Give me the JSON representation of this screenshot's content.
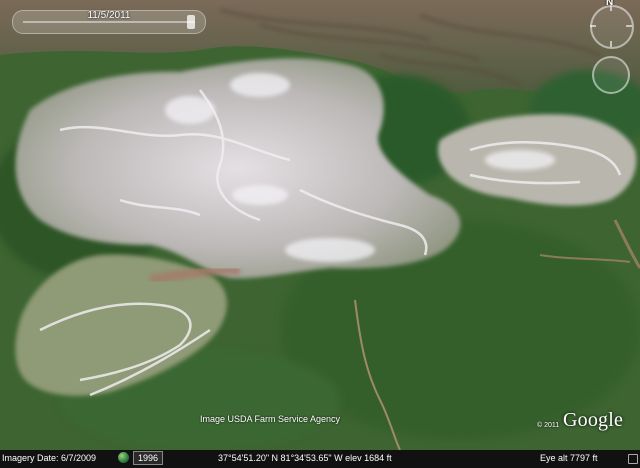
{
  "time_slider": {
    "date": "11/5/2011"
  },
  "nav": {
    "north": "N"
  },
  "attribution": "Image USDA Farm Service Agency",
  "copyright": "© 2011",
  "logo": "Google",
  "status": {
    "imagery_date": "Imagery Date: 6/7/2009",
    "year": "1996",
    "coordinates": "37°54'51.20\" N   81°34'53.65\" W  elev  1684 ft",
    "eye_alt": "Eye alt    7797 ft"
  },
  "colors": {
    "forest": "#3f6a34",
    "mine": "#c9c4c4",
    "ridge": "#6b5c4a"
  }
}
